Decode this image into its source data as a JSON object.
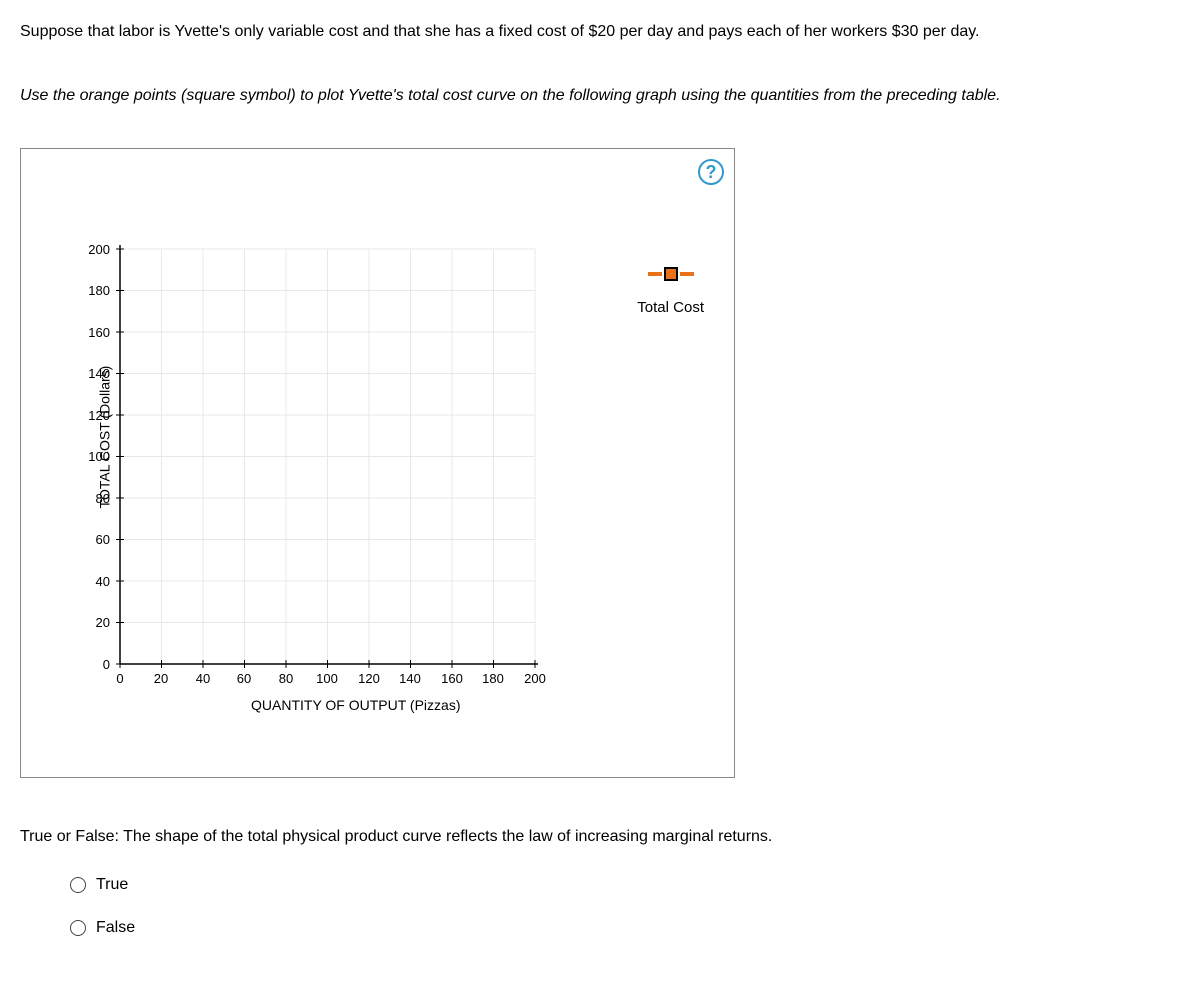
{
  "intro_text": "Suppose that labor is Yvette's only variable cost and that she has a fixed cost of $20 per day and pays each of her workers $30 per day.",
  "instruction_text": "Use the orange points (square symbol) to plot Yvette's total cost curve on the following graph using the quantities from the preceding table.",
  "help_glyph": "?",
  "chart_data": {
    "type": "line",
    "title": "",
    "xlabel": "QUANTITY OF OUTPUT (Pizzas)",
    "ylabel": "TOTAL COST (Dollars)",
    "xlim": [
      0,
      200
    ],
    "ylim": [
      0,
      200
    ],
    "x_ticks": [
      0,
      20,
      40,
      60,
      80,
      100,
      120,
      140,
      160,
      180,
      200
    ],
    "y_ticks": [
      0,
      20,
      40,
      60,
      80,
      100,
      120,
      140,
      160,
      180,
      200
    ],
    "series": [],
    "legend": {
      "label": "Total Cost",
      "symbol": "square",
      "color": "#e8711a"
    }
  },
  "question2_text": "True or False: The shape of the total physical product curve reflects the law of increasing marginal returns.",
  "options": {
    "true_label": "True",
    "false_label": "False"
  }
}
